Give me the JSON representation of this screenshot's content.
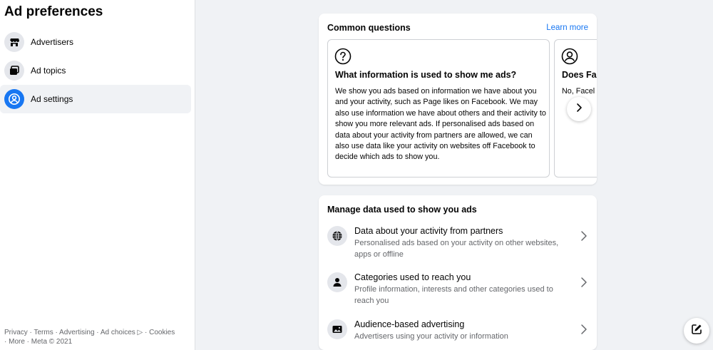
{
  "sidebar": {
    "title": "Ad preferences",
    "items": [
      {
        "label": "Advertisers",
        "icon": "storefront-icon",
        "active": false
      },
      {
        "label": "Ad topics",
        "icon": "ad-topics-icon",
        "active": false
      },
      {
        "label": "Ad settings",
        "icon": "person-circle-icon",
        "active": true
      }
    ],
    "footer": {
      "line1": "Privacy · Terms · Advertising · Ad choices ▷ · Cookies",
      "line2": "· More · Meta © 2021"
    }
  },
  "common_questions": {
    "title": "Common questions",
    "learn_more": "Learn more",
    "cards": [
      {
        "icon": "question-circle-icon",
        "title": "What information is used to show me ads?",
        "body": "We show you ads based on information we have about you and your activity, such as Page likes on Facebook. We may also use information we have about others and their activity to show you more relevant ads. If personalised ads based on data about your activity from partners are allowed, we can also use data like your activity on websites off Facebook to decide which ads to show you."
      },
      {
        "icon": "person-circle-icon",
        "title": "Does Fa",
        "body": "No, Facel pe al"
      }
    ]
  },
  "manage_data": {
    "title": "Manage data used to show you ads",
    "rows": [
      {
        "icon": "globe-icon",
        "title": "Data about your activity from partners",
        "desc": "Personalised ads based on your activity on other websites, apps or offline"
      },
      {
        "icon": "person-icon",
        "title": "Categories used to reach you",
        "desc": "Profile information, interests and other categories used to reach you"
      },
      {
        "icon": "image-icon",
        "title": "Audience-based advertising",
        "desc": "Advertisers using your activity or information"
      }
    ]
  },
  "colors": {
    "accent": "#1877f2",
    "background": "#f0f2f5",
    "secondary_text": "#65676b"
  }
}
